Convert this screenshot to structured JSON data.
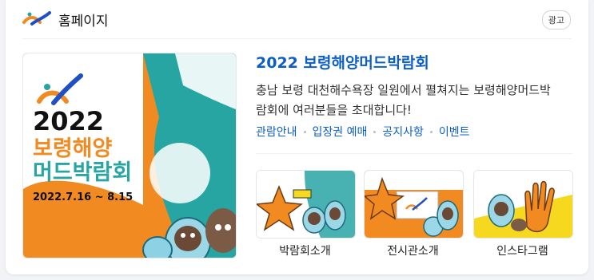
{
  "header": {
    "site_name": "홈페이지",
    "ad_badge": "광고"
  },
  "thumbnail": {
    "year": "2022",
    "line1": "보령해양",
    "line2": "머드박람회",
    "dates": "2022.7.16 ~ 8.15"
  },
  "title": "2022 보령해양머드박람회",
  "description": "충남 보령 대천해수욕장 일원에서 펼쳐지는 보령해양머드박람회에 여러분들을 초대합니다!",
  "links": [
    "관람안내",
    "입장권 예매",
    "공지사항",
    "이벤트"
  ],
  "tiles": [
    {
      "label": "박람회소개"
    },
    {
      "label": "전시관소개"
    },
    {
      "label": "인스타그램"
    }
  ],
  "colors": {
    "link": "#0b5ec7",
    "accent_orange": "#f28a22",
    "accent_teal": "#27a5a3",
    "accent_yellow": "#f6d81e"
  }
}
